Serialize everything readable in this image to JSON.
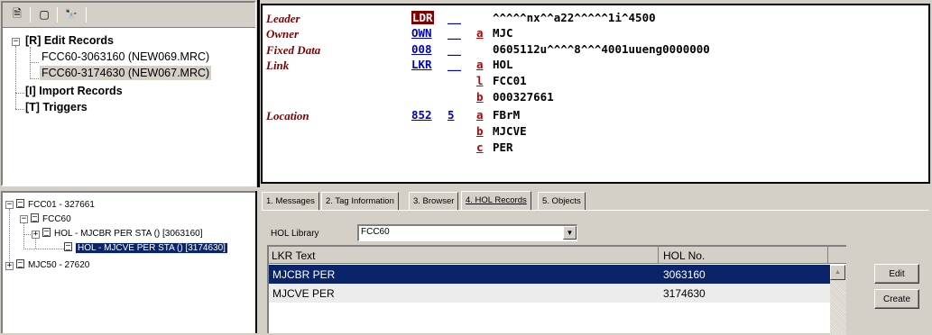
{
  "toolbar": {
    "icons": [
      "properties-icon",
      "window-icon",
      "binoculars-icon"
    ],
    "glyphs": [
      "🗎",
      "▢",
      "🔭"
    ]
  },
  "tree": {
    "edit_records": "[R] Edit Records",
    "edit_children": [
      "FCC60-3063160 (NEW069.MRC)",
      "FCC60-3174630 (NEW067.MRC)"
    ],
    "import_records": "[I] Import Records",
    "triggers": "[T] Triggers"
  },
  "marc": {
    "leader_label": "Leader",
    "leader_tag": "LDR",
    "leader_value": "^^^^^nx^^a22^^^^^1i^4500",
    "owner_label": "Owner",
    "owner_tag": "OWN",
    "owner_sub": "a",
    "owner_value": "MJC",
    "fixed_label": "Fixed Data",
    "fixed_tag": "008",
    "fixed_value": "0605112u^^^^8^^^4001uueng0000000",
    "link_label": "Link",
    "link_tag": "LKR",
    "link_subs": [
      {
        "code": "a",
        "value": "HOL"
      },
      {
        "code": "l",
        "value": "FCC01"
      },
      {
        "code": "b",
        "value": "000327661"
      }
    ],
    "location_label": "Location",
    "location_tag": "852",
    "location_ind": "5",
    "location_subs": [
      {
        "code": "a",
        "value": "FBrM"
      },
      {
        "code": "b",
        "value": "MJCVE"
      },
      {
        "code": "c",
        "value": "PER"
      }
    ],
    "blank_ind": "__"
  },
  "hol_tree": {
    "root": "FCC01 - 327661",
    "fcc60": "FCC60",
    "items": [
      "HOL - MJCBR PER STA () [3063160]",
      "HOL - MJCVE PER STA () [3174630]"
    ],
    "mjc50": "MJC50 - 27620"
  },
  "tabs": [
    "1. Messages",
    "2. Tag Information",
    "3. Browser",
    "4. HOL Records",
    "5. Objects"
  ],
  "hol_panel": {
    "library_label": "HOL Library",
    "library_value": "FCC60",
    "col_lkr": "LKR Text",
    "col_hol": "HOL No.",
    "rows": [
      {
        "text": "MJCBR PER",
        "hol": "3063160"
      },
      {
        "text": "MJCVE PER",
        "hol": "3174630"
      }
    ],
    "edit_label": "Edit",
    "create_label": "Create"
  }
}
